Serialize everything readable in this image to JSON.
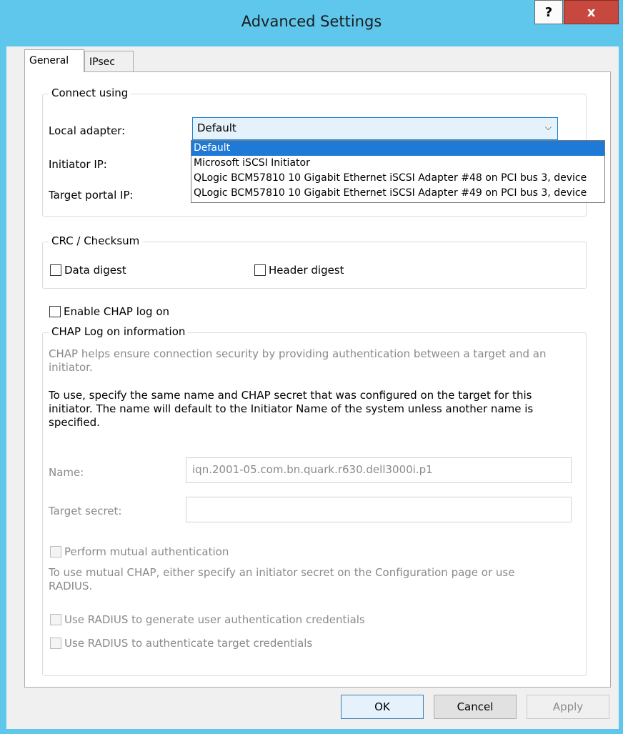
{
  "window": {
    "title": "Advanced Settings",
    "help_label": "?",
    "close_label": "x"
  },
  "tabs": [
    {
      "label": "General"
    },
    {
      "label": "IPsec"
    }
  ],
  "connect": {
    "group_label": "Connect using",
    "local_adapter_label": "Local adapter:",
    "local_adapter_value": "Default",
    "initiator_ip_label": "Initiator IP:",
    "target_portal_ip_label": "Target portal IP:",
    "options": [
      "Default",
      "Microsoft iSCSI Initiator",
      "QLogic BCM57810 10 Gigabit Ethernet iSCSI Adapter #48 on PCI bus 3, device",
      "QLogic BCM57810 10 Gigabit Ethernet iSCSI Adapter #49 on PCI bus 3, device"
    ]
  },
  "crc": {
    "group_label": "CRC / Checksum",
    "data_digest": "Data digest",
    "header_digest": "Header digest"
  },
  "chap": {
    "enable_label": "Enable CHAP log on",
    "group_label": "CHAP Log on information",
    "intro": "CHAP helps ensure connection security by providing authentication between a target and an initiator.",
    "instructions": "To use, specify the same name and CHAP secret that was configured on the target for this initiator.  The name will default to the Initiator Name of the system unless another name is specified.",
    "name_label": "Name:",
    "name_value": "iqn.2001-05.com.bn.quark.r630.dell3000i.p1",
    "secret_label": "Target secret:",
    "secret_value": "",
    "mutual_label": "Perform mutual authentication",
    "mutual_note": "To use mutual CHAP, either specify an initiator secret on the Configuration page or use RADIUS.",
    "radius_generate_label": "Use RADIUS to generate user authentication credentials",
    "radius_auth_label": "Use RADIUS to authenticate target credentials"
  },
  "buttons": {
    "ok": "OK",
    "cancel": "Cancel",
    "apply": "Apply"
  }
}
